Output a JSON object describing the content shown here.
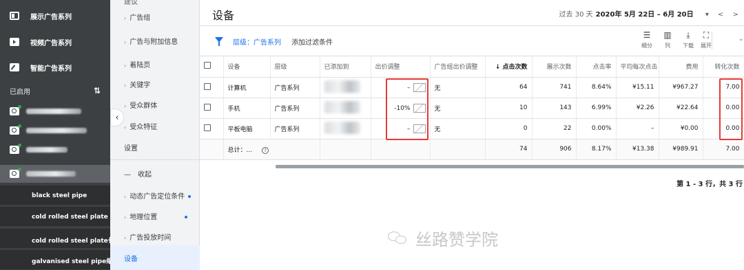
{
  "sidebar": {
    "campaigns": [
      {
        "label": "展示广告系列",
        "icon": "display-icon"
      },
      {
        "label": "视频广告系列",
        "icon": "video-icon"
      },
      {
        "label": "智能广告系列",
        "icon": "smart-icon"
      }
    ],
    "section_label": "已启用",
    "sort_icon": "sort-icon",
    "keywords": [
      "black steel pipe",
      "cold rolled steel plate",
      "cold rolled steel plate长尾词",
      "galvanised steel pipe缩写词"
    ]
  },
  "nav": {
    "partial_top": "建议",
    "items": [
      {
        "label": "广告组",
        "arrow": true,
        "dot": false
      },
      {
        "label": "广告与附加信息",
        "arrow": true,
        "dot": false
      },
      {
        "label": "着陆页",
        "arrow": true,
        "dot": false
      },
      {
        "label": "关键字",
        "arrow": true,
        "dot": false
      },
      {
        "label": "受众群体",
        "arrow": true,
        "dot": false
      },
      {
        "label": "受众特征",
        "arrow": true,
        "dot": false
      },
      {
        "label": "设置",
        "arrow": false,
        "dot": false
      },
      {
        "label": "收起",
        "arrow": false,
        "dot": false
      },
      {
        "label": "动态广告定位条件",
        "arrow": true,
        "dot": true
      },
      {
        "label": "地理位置",
        "arrow": true,
        "dot": true
      },
      {
        "label": "广告投放时间",
        "arrow": true,
        "dot": false
      }
    ],
    "collapse_prefix": "—",
    "active": "设备"
  },
  "header": {
    "title": "设备",
    "date_prefix": "过去 30 天",
    "date_range": "2020年 5月 22日 – 6月 20日",
    "dropdown_glyph": "▾",
    "prev_glyph": "<",
    "next_glyph": ">"
  },
  "filter": {
    "level": "层级：广告系列",
    "add": "添加过滤条件"
  },
  "toolbar": {
    "segment": "细分",
    "columns": "列",
    "download": "下载",
    "expand": "展开"
  },
  "table": {
    "headers": [
      "设备",
      "层级",
      "已添加到",
      "出价调整",
      "广告组出价调整",
      "点击次数",
      "展示次数",
      "点击率",
      "平均每次点击",
      "费用",
      "转化次数"
    ],
    "sort_arrow": "↓",
    "rows": [
      {
        "device": "计算机",
        "level": "广告系列",
        "bid": "–",
        "group_bid": "无",
        "clicks": "64",
        "impr": "741",
        "ctr": "8.64%",
        "cpc": "¥15.11",
        "cost": "¥967.27",
        "conv": "7.00"
      },
      {
        "device": "手机",
        "level": "广告系列",
        "bid": "-10%",
        "group_bid": "无",
        "clicks": "10",
        "impr": "143",
        "ctr": "6.99%",
        "cpc": "¥2.26",
        "cost": "¥22.64",
        "conv": "0.00"
      },
      {
        "device": "平板电脑",
        "level": "广告系列",
        "bid": "–",
        "group_bid": "无",
        "clicks": "0",
        "impr": "22",
        "ctr": "0.00%",
        "cpc": "–",
        "cost": "¥0.00",
        "conv": "0.00"
      }
    ],
    "total": {
      "label": "总计：...",
      "clicks": "74",
      "impr": "906",
      "ctr": "8.17%",
      "cpc": "¥13.38",
      "cost": "¥989.91",
      "conv": "7.00"
    }
  },
  "pager": "第 1 - 3 行，共 3 行",
  "watermark": "丝路赞学院",
  "colors": {
    "accent": "#1a73e8",
    "highlight": "#e53935",
    "sidebar": "#3c4043"
  }
}
